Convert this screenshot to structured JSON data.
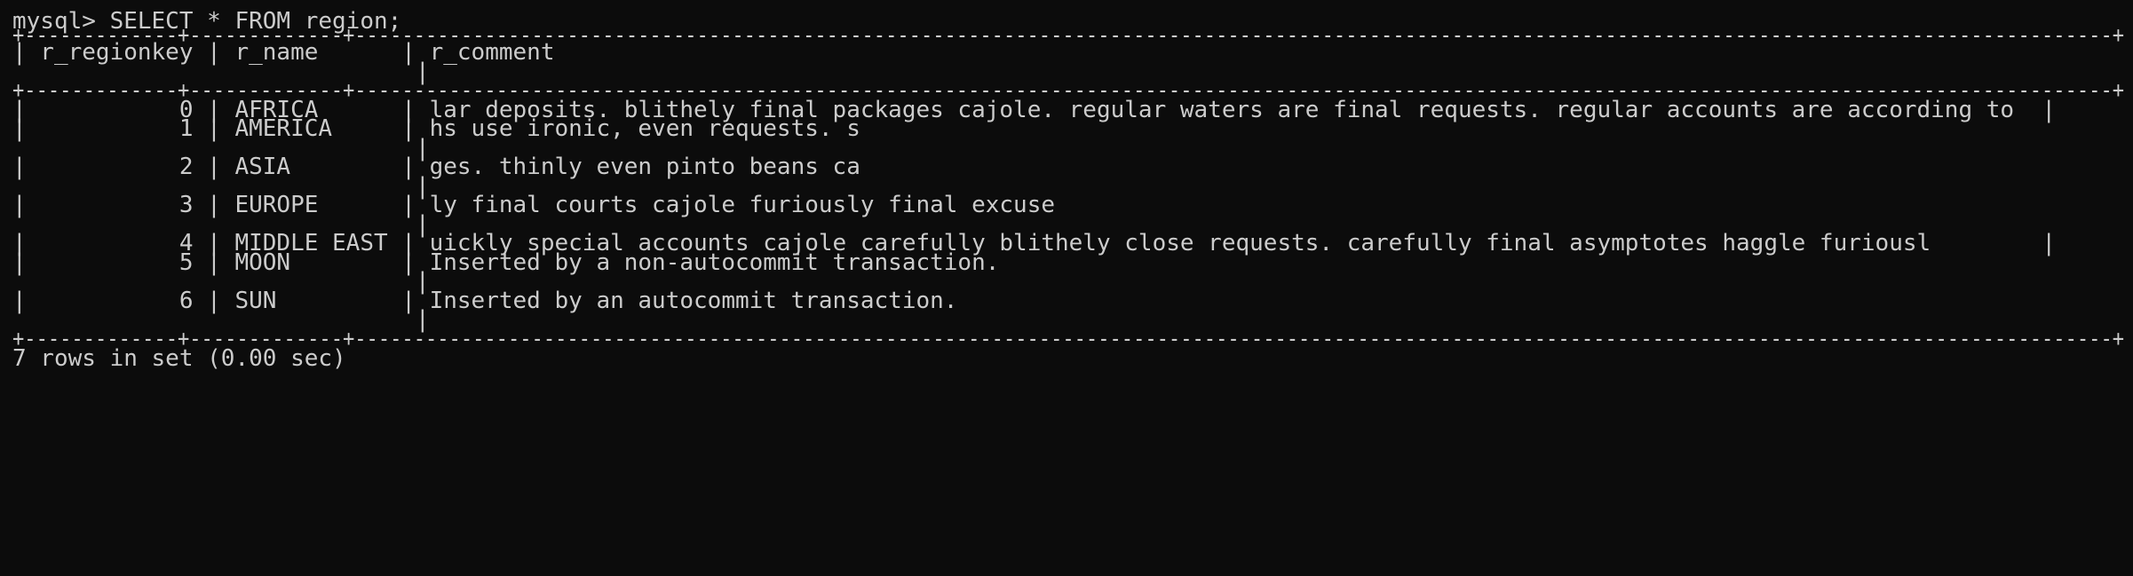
{
  "terminal": {
    "lines": [
      "mysql> SELECT * FROM region;",
      "+-------------+-------------+-----------------------------------------------------------------------------------------------------------------------------------------------------+",
      "| r_regionkey | r_name      | r_comment",
      "                             |",
      "+-------------+-------------+-----------------------------------------------------------------------------------------------------------------------------------------------------+",
      "|           0 | AFRICA      | lar deposits. blithely final packages cajole. regular waters are final requests. regular accounts are according to  |",
      "|           1 | AMERICA     | hs use ironic, even requests. s",
      "                             |",
      "|           2 | ASIA        | ges. thinly even pinto beans ca",
      "                             |",
      "|           3 | EUROPE      | ly final courts cajole furiously final excuse",
      "                             |",
      "|           4 | MIDDLE EAST | uickly special accounts cajole carefully blithely close requests. carefully final asymptotes haggle furiousl        |",
      "|           5 | MOON        | Inserted by a non-autocommit transaction.",
      "                             |",
      "|           6 | SUN         | Inserted by an autocommit transaction.",
      "                             |",
      "+-------------+-------------+-----------------------------------------------------------------------------------------------------------------------------------------------------+",
      "7 rows in set (0.00 sec)"
    ]
  },
  "colors": {
    "background": "#0c0c0c",
    "foreground": "#cccccc"
  }
}
